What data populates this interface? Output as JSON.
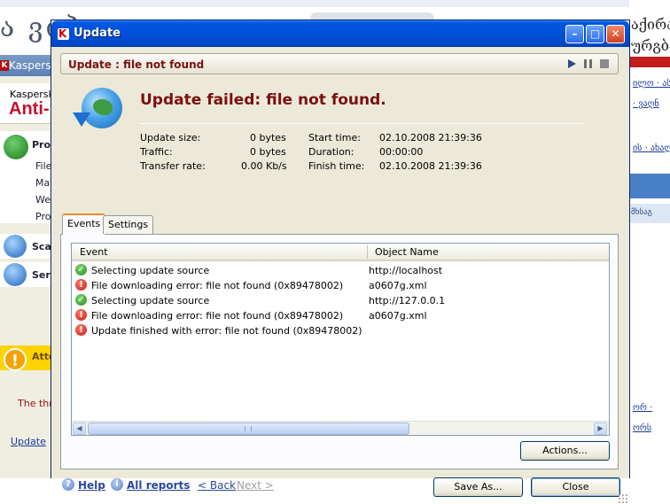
{
  "background": {
    "left_script": "ა ვიპ",
    "kav_app": {
      "title": "Kaspersky",
      "logo_top": "Kaspersky",
      "logo_bottom": "Anti-",
      "protection_label": "Prot",
      "protection_items": [
        "File",
        "Mai",
        "We",
        "Pro"
      ],
      "scan_label": "Sca",
      "service_label": "Serv",
      "attention_label": "Atte",
      "threat_text": "The thre",
      "update_link": "Update"
    },
    "web_right": {
      "script_lines": [
        "აქირა",
        "ურგბა"
      ],
      "links": [
        "ილო · ას",
        "· ვაღნ",
        "ის · ახალი",
        "მხსაგ",
        "ორ ·",
        "ორს"
      ]
    }
  },
  "window": {
    "title": "Update",
    "header_text": "Update : file not found",
    "failed_title": "Update failed: file not found.",
    "stats": {
      "update_size_label": "Update size:",
      "update_size": "0 bytes",
      "traffic_label": "Traffic:",
      "traffic": "0 bytes",
      "transfer_rate_label": "Transfer rate:",
      "transfer_rate": "0.00 Kb/s",
      "start_time_label": "Start time:",
      "start_time": "02.10.2008 21:39:36",
      "duration_label": "Duration:",
      "duration": "00:00:00",
      "finish_time_label": "Finish time:",
      "finish_time": "02.10.2008 21:39:36"
    },
    "tabs": [
      "Events",
      "Settings"
    ],
    "list": {
      "columns": [
        "Event",
        "Object Name"
      ],
      "rows": [
        {
          "status": "ok",
          "event": "Selecting update source",
          "object": "http://localhost"
        },
        {
          "status": "error",
          "event": "File downloading error: file not found (0x89478002)",
          "object": "a0607g.xml"
        },
        {
          "status": "ok",
          "event": "Selecting update source",
          "object": "http://127.0.0.1"
        },
        {
          "status": "error",
          "event": "File downloading error: file not found (0x89478002)",
          "object": "a0607g.xml"
        },
        {
          "status": "error",
          "event": "Update finished with error: file not found (0x89478002)",
          "object": ""
        }
      ]
    },
    "actions_button": "Actions...",
    "footer": {
      "help": "Help",
      "all_reports": "All reports",
      "back": "< Back",
      "next": "Next >",
      "save_as": "Save As...",
      "close": "Close"
    },
    "colors": {
      "title_red": "#7b1010",
      "xp_blue": "#0050d8",
      "window_bg": "#ece9d8"
    }
  }
}
